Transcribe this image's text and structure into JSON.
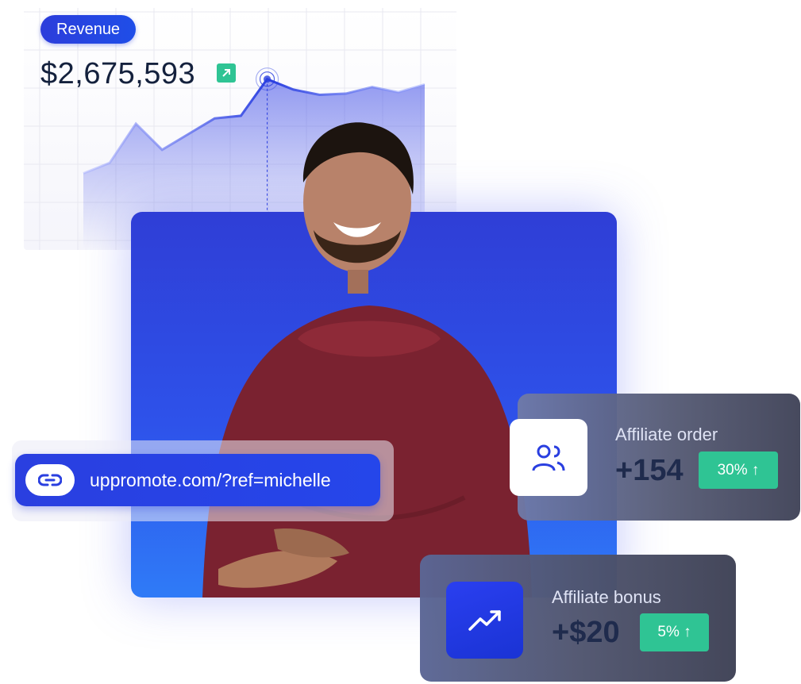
{
  "revenue": {
    "badge_label": "Revenue",
    "value": "$2,675,593"
  },
  "chart_data": {
    "type": "line",
    "x": [
      1,
      2,
      3,
      4,
      5,
      6,
      7,
      8,
      9,
      10,
      11,
      12,
      13,
      14
    ],
    "series": [
      {
        "values": [
          0.1,
          0.18,
          0.48,
          0.28,
          0.4,
          0.52,
          0.54,
          0.82,
          0.74,
          0.7,
          0.71,
          0.76,
          0.72,
          0.78
        ]
      }
    ],
    "highlight_index": 7,
    "grid": true
  },
  "link": {
    "icon": "link-icon",
    "url_text": "uppromote.com/?ref=michelle"
  },
  "affiliate_order": {
    "icon": "users-icon",
    "label": "Affiliate order",
    "value": "+154",
    "change": "30% ↑"
  },
  "affiliate_bonus": {
    "icon": "trending-up-icon",
    "label": "Affiliate bonus",
    "value": "+$20",
    "change": "5% ↑"
  },
  "colors": {
    "accent": "#2c3ddb",
    "positive": "#2fc494",
    "hoodie": "#7a2230"
  }
}
